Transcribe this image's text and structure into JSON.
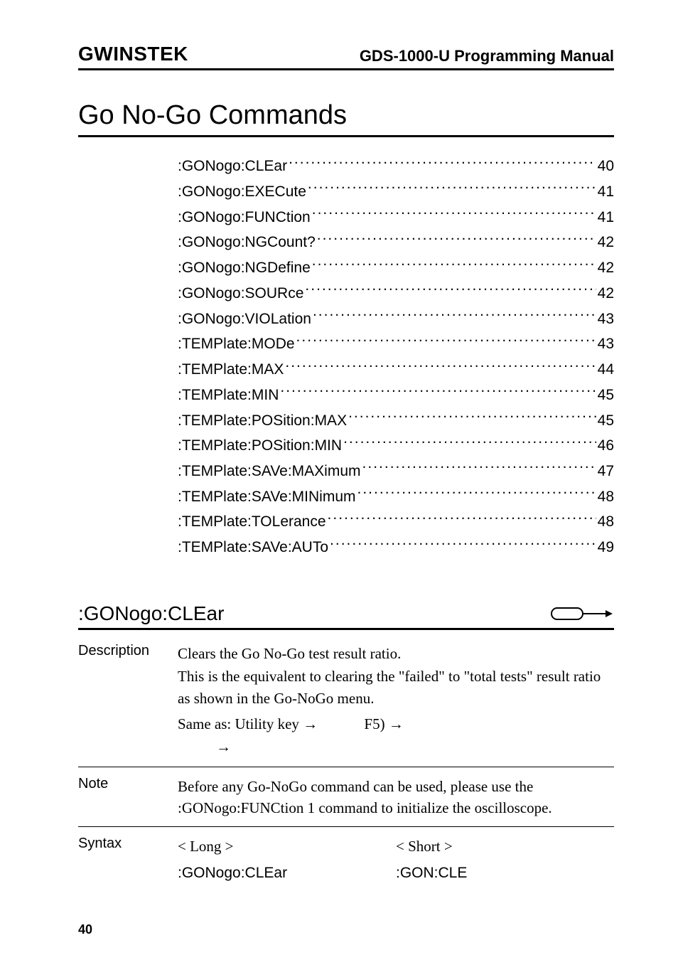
{
  "header": {
    "logo_text": "GWINSTEK",
    "doc_title": "GDS-1000-U Programming Manual"
  },
  "section_title": "Go No-Go Commands",
  "toc": [
    {
      "label": ":GONogo:CLEar",
      "page": "40"
    },
    {
      "label": ":GONogo:EXECute",
      "page": "41"
    },
    {
      "label": ":GONogo:FUNCtion",
      "page": "41"
    },
    {
      "label": ":GONogo:NGCount?",
      "page": "42"
    },
    {
      "label": ":GONogo:NGDefine",
      "page": "42"
    },
    {
      "label": ":GONogo:SOURce",
      "page": "42"
    },
    {
      "label": ":GONogo:VIOLation",
      "page": "43"
    },
    {
      "label": ":TEMPlate:MODe",
      "page": "43"
    },
    {
      "label": ":TEMPlate:MAX",
      "page": "44"
    },
    {
      "label": ":TEMPlate:MIN",
      "page": "45"
    },
    {
      "label": ":TEMPlate:POSition:MAX",
      "page": "45"
    },
    {
      "label": ":TEMPlate:POSition:MIN",
      "page": "46"
    },
    {
      "label": ":TEMPlate:SAVe:MAXimum",
      "page": "47"
    },
    {
      "label": ":TEMPlate:SAVe:MINimum",
      "page": "48"
    },
    {
      "label": ":TEMPlate:TOLerance",
      "page": "48"
    },
    {
      "label": ":TEMPlate:SAVe:AUTo",
      "page": "49"
    }
  ],
  "command": {
    "heading": ":GONogo:CLEar",
    "description_label": "Description",
    "description_body_1": "Clears the Go No-Go test result ratio.",
    "description_body_2": "This is the equivalent to clearing the \"failed\" to \"total tests\" result ratio as shown in the Go-NoGo menu.",
    "same_as_prefix": "Same as: Utility key →",
    "same_as_f5": "F5) →",
    "same_as_arrow2": "→",
    "note_label": "Note",
    "note_body": "Before any Go-NoGo command can be used, please use the :GONogo:FUNCtion 1 command to initialize the oscilloscope.",
    "syntax_label": "Syntax",
    "syntax_long_head": "< Long >",
    "syntax_short_head": "< Short >",
    "syntax_long_val": ":GONogo:CLEar",
    "syntax_short_val": ":GON:CLE"
  },
  "page_number": "40"
}
